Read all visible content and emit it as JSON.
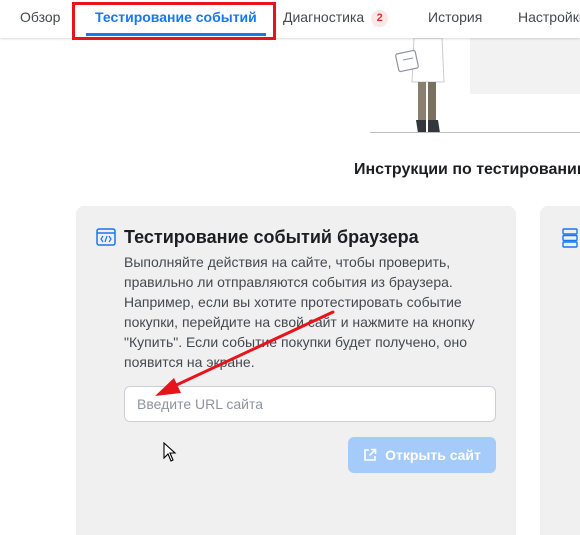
{
  "tabs": [
    {
      "label": "Обзор"
    },
    {
      "label": "Тестирование событий"
    },
    {
      "label": "Диагностика",
      "badge": "2"
    },
    {
      "label": "История"
    },
    {
      "label": "Настройки"
    }
  ],
  "active_tab": "Тестирование событий",
  "colors": {
    "accent": "#1877f2",
    "annotation": "#e8141b",
    "button_disabled": "#a4cbf9",
    "card_bg": "#f0f0f0"
  },
  "section": {
    "title": "Инструкции по тестированию"
  },
  "browser_card": {
    "icon": "code-window-icon",
    "title": "Тестирование событий браузера",
    "description": "Выполняйте действия на сайте, чтобы проверить, правильно ли отправляются события из браузера. Например, если вы хотите протестировать событие покупки, перейдите на свой сайт и нажмите на кнопку \"Купить\". Если событие покупки будет получено, оно появится на экране.",
    "url_input": {
      "value": "",
      "placeholder": "Введите URL сайта"
    },
    "open_button": {
      "label": "Открыть сайт",
      "icon": "external-link-icon"
    }
  },
  "server_card": {
    "icon": "server-icon"
  }
}
